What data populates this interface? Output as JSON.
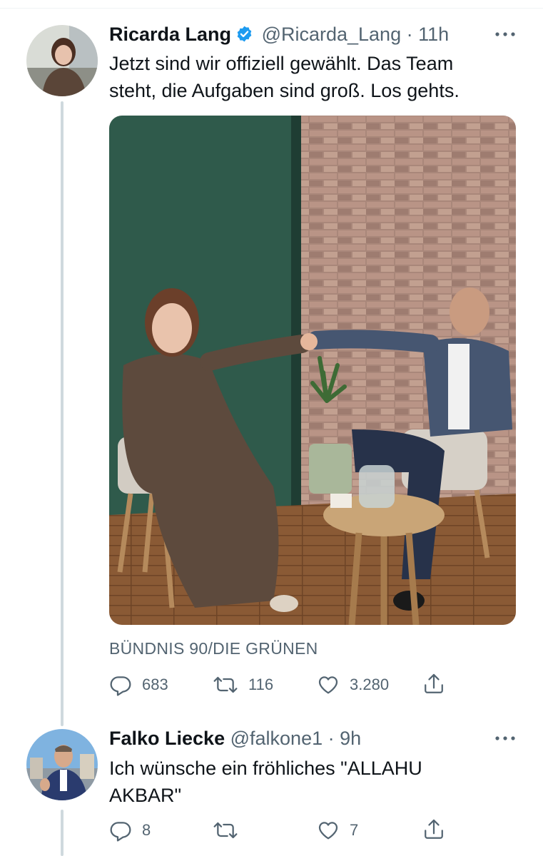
{
  "tweets": [
    {
      "name": "Ricarda Lang",
      "handle": "@Ricarda_Lang",
      "separator": "·",
      "time": "11h",
      "text_lines": [
        "Jetzt sind wir offiziell gewählt. Das Team",
        "steht, die Aufgaben sind groß. Los gehts."
      ],
      "source": "BÜNDNIS 90/DIE GRÜNEN",
      "replies": "683",
      "retweets": "116",
      "likes": "3.280",
      "verified": true
    },
    {
      "name": "Falko Liecke",
      "handle": "@falkone1",
      "separator": "·",
      "time": "9h",
      "text_lines": [
        "Ich wünsche ein fröhliches \"ALLAHU",
        "AKBAR\""
      ],
      "replies": "8",
      "retweets": "",
      "likes": "7"
    }
  ],
  "colors": {
    "verified": "#1d9bf0",
    "secondary_text": "#536471",
    "thread_line": "#cfd9de"
  },
  "icons": [
    "verified-badge-icon",
    "more-icon",
    "reply-icon",
    "retweet-icon",
    "like-icon",
    "share-icon"
  ]
}
